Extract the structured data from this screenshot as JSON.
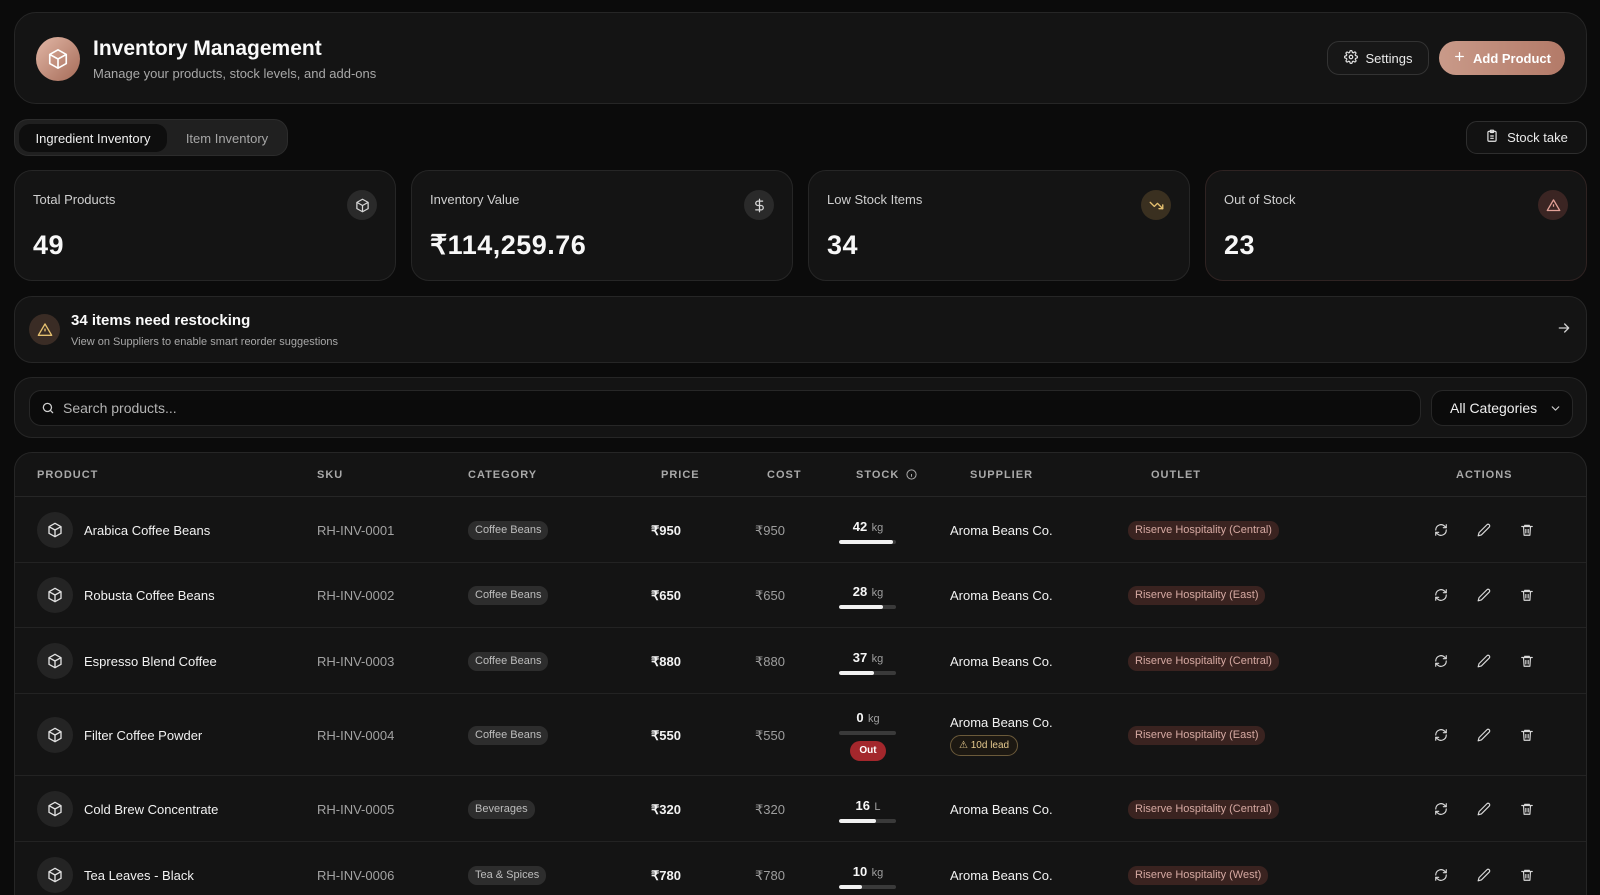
{
  "header": {
    "title": "Inventory Management",
    "subtitle": "Manage your products, stock levels, and add-ons",
    "settings_label": "Settings",
    "add_product_label": "Add Product"
  },
  "tabs": [
    {
      "label": "Ingredient Inventory",
      "active": true
    },
    {
      "label": "Item Inventory",
      "active": false
    }
  ],
  "stock_take_label": "Stock take",
  "stats": [
    {
      "label": "Total Products",
      "value": "49",
      "icon": "cube-icon"
    },
    {
      "label": "Inventory Value",
      "value": "₹114,259.76",
      "icon": "dollar-icon"
    },
    {
      "label": "Low Stock Items",
      "value": "34",
      "icon": "trending-down-icon"
    },
    {
      "label": "Out of Stock",
      "value": "23",
      "icon": "alert-triangle-icon"
    }
  ],
  "restock": {
    "title": "34 items need restocking",
    "subtitle": "View on Suppliers to enable smart reorder suggestions"
  },
  "search": {
    "placeholder": "Search products...",
    "category_selected": "All Categories"
  },
  "table": {
    "columns": [
      "PRODUCT",
      "SKU",
      "CATEGORY",
      "PRICE",
      "COST",
      "STOCK",
      "SUPPLIER",
      "OUTLET",
      "ACTIONS"
    ],
    "rows": [
      {
        "product": "Arabica Coffee Beans",
        "sku": "RH-INV-0001",
        "category": "Coffee Beans",
        "price": "₹950",
        "cost": "₹950",
        "stock": "42",
        "unit": "kg",
        "stock_level": 0.95,
        "supplier": "Aroma Beans Co.",
        "outlet": "Riserve Hospitality (Central)"
      },
      {
        "product": "Robusta Coffee Beans",
        "sku": "RH-INV-0002",
        "category": "Coffee Beans",
        "price": "₹650",
        "cost": "₹650",
        "stock": "28",
        "unit": "kg",
        "stock_level": 0.78,
        "supplier": "Aroma Beans Co.",
        "outlet": "Riserve Hospitality (East)"
      },
      {
        "product": "Espresso Blend Coffee",
        "sku": "RH-INV-0003",
        "category": "Coffee Beans",
        "price": "₹880",
        "cost": "₹880",
        "stock": "37",
        "unit": "kg",
        "stock_level": 0.62,
        "supplier": "Aroma Beans Co.",
        "outlet": "Riserve Hospitality (Central)"
      },
      {
        "product": "Filter Coffee Powder",
        "sku": "RH-INV-0004",
        "category": "Coffee Beans",
        "price": "₹550",
        "cost": "₹550",
        "stock": "0",
        "unit": "kg",
        "stock_level": 0,
        "out_label": "Out",
        "supplier": "Aroma Beans Co.",
        "lead_label": "10d lead",
        "outlet": "Riserve Hospitality (East)"
      },
      {
        "product": "Cold Brew Concentrate",
        "sku": "RH-INV-0005",
        "category": "Beverages",
        "price": "₹320",
        "cost": "₹320",
        "stock": "16",
        "unit": "L",
        "stock_level": 0.65,
        "supplier": "Aroma Beans Co.",
        "outlet": "Riserve Hospitality (Central)"
      },
      {
        "product": "Tea Leaves - Black",
        "sku": "RH-INV-0006",
        "category": "Tea & Spices",
        "price": "₹780",
        "cost": "₹780",
        "stock": "10",
        "unit": "kg",
        "stock_level": 0.4,
        "supplier": "Aroma Beans Co.",
        "outlet": "Riserve Hospitality (West)"
      }
    ]
  },
  "colors": {
    "accent": "#c08d7b",
    "out_badge": "#a3272c",
    "lead_badge": "#e5c98e"
  }
}
